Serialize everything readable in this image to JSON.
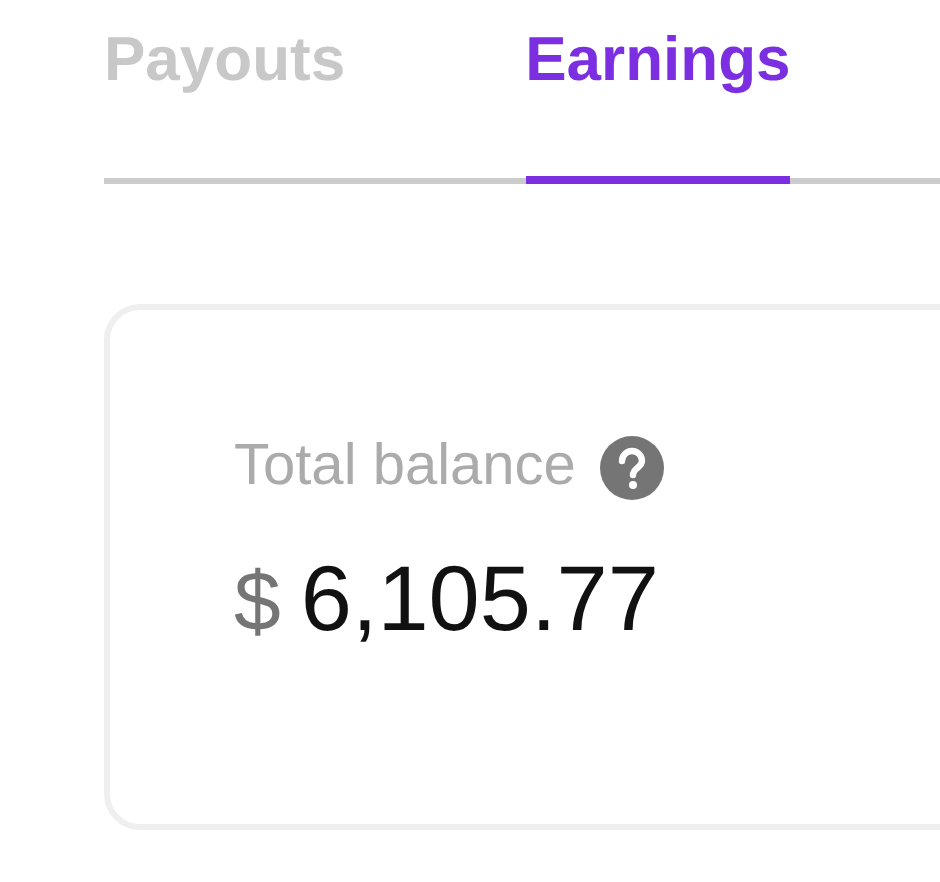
{
  "tabs": [
    {
      "label": "Payouts",
      "selected": false
    },
    {
      "label": "Earnings",
      "selected": true
    }
  ],
  "balance": {
    "label": "Total balance",
    "currency": "$",
    "amount": "6,105.77"
  }
}
